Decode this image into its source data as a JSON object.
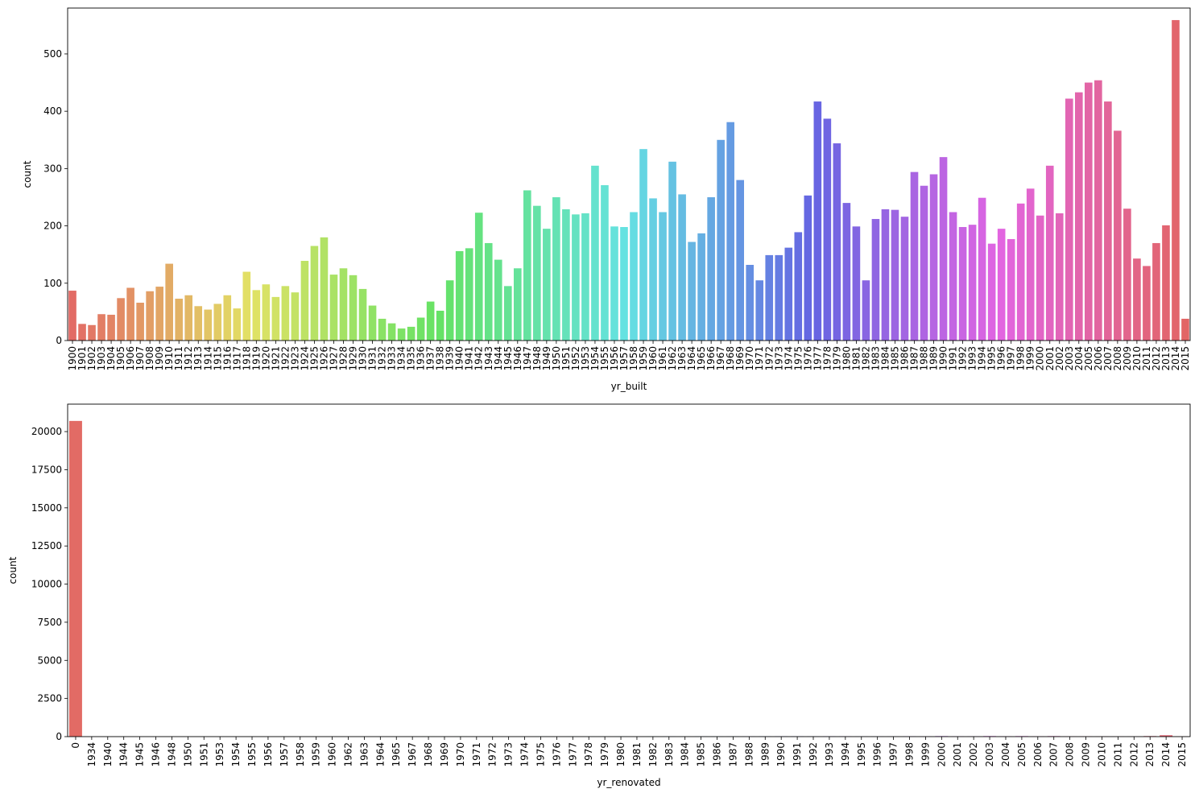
{
  "chart_data": [
    {
      "type": "bar",
      "xlabel": "yr_built",
      "ylabel": "count",
      "ylim": [
        0,
        580
      ],
      "yticks": [
        0,
        100,
        200,
        300,
        400,
        500
      ],
      "grid": false,
      "legend": "none",
      "palette": "husl",
      "categories": [
        "1900",
        "1901",
        "1902",
        "1903",
        "1904",
        "1905",
        "1906",
        "1907",
        "1908",
        "1909",
        "1910",
        "1911",
        "1912",
        "1913",
        "1914",
        "1915",
        "1916",
        "1917",
        "1918",
        "1919",
        "1920",
        "1921",
        "1922",
        "1923",
        "1924",
        "1925",
        "1926",
        "1927",
        "1928",
        "1929",
        "1930",
        "1931",
        "1932",
        "1933",
        "1934",
        "1935",
        "1936",
        "1937",
        "1938",
        "1939",
        "1940",
        "1941",
        "1942",
        "1943",
        "1944",
        "1945",
        "1946",
        "1947",
        "1948",
        "1949",
        "1950",
        "1951",
        "1952",
        "1953",
        "1954",
        "1955",
        "1956",
        "1957",
        "1958",
        "1959",
        "1960",
        "1961",
        "1962",
        "1963",
        "1964",
        "1965",
        "1966",
        "1967",
        "1968",
        "1969",
        "1970",
        "1971",
        "1972",
        "1973",
        "1974",
        "1975",
        "1976",
        "1977",
        "1978",
        "1979",
        "1980",
        "1981",
        "1982",
        "1983",
        "1984",
        "1985",
        "1986",
        "1987",
        "1988",
        "1989",
        "1990",
        "1991",
        "1992",
        "1993",
        "1994",
        "1995",
        "1996",
        "1997",
        "1998",
        "1999",
        "2000",
        "2001",
        "2002",
        "2003",
        "2004",
        "2005",
        "2006",
        "2007",
        "2008",
        "2009",
        "2010",
        "2011",
        "2012",
        "2013",
        "2014",
        "2015"
      ],
      "values": [
        87,
        29,
        27,
        46,
        45,
        74,
        92,
        66,
        86,
        94,
        134,
        73,
        79,
        60,
        54,
        64,
        79,
        56,
        120,
        88,
        98,
        76,
        95,
        84,
        139,
        165,
        180,
        115,
        126,
        114,
        90,
        61,
        38,
        30,
        21,
        24,
        40,
        68,
        52,
        105,
        156,
        161,
        223,
        170,
        141,
        95,
        126,
        262,
        235,
        195,
        250,
        229,
        220,
        222,
        305,
        271,
        199,
        198,
        224,
        334,
        248,
        224,
        312,
        255,
        172,
        187,
        250,
        350,
        381,
        280,
        132,
        105,
        149,
        149,
        162,
        189,
        253,
        417,
        387,
        344,
        240,
        199,
        105,
        212,
        229,
        228,
        216,
        294,
        270,
        290,
        320,
        224,
        198,
        202,
        249,
        169,
        195,
        177,
        239,
        265,
        218,
        305,
        222,
        422,
        433,
        450,
        454,
        417,
        366,
        230,
        143,
        130,
        170,
        201,
        559,
        38
      ]
    },
    {
      "type": "bar",
      "xlabel": "yr_renovated",
      "ylabel": "count",
      "ylim": [
        0,
        21800
      ],
      "yticks": [
        0,
        2500,
        5000,
        7500,
        10000,
        12500,
        15000,
        17500,
        20000
      ],
      "grid": false,
      "legend": "none",
      "palette": "husl",
      "categories": [
        "0",
        "1934",
        "1940",
        "1944",
        "1945",
        "1946",
        "1948",
        "1950",
        "1951",
        "1953",
        "1954",
        "1955",
        "1956",
        "1957",
        "1958",
        "1959",
        "1960",
        "1962",
        "1963",
        "1964",
        "1965",
        "1967",
        "1968",
        "1969",
        "1970",
        "1971",
        "1972",
        "1973",
        "1974",
        "1975",
        "1976",
        "1977",
        "1978",
        "1979",
        "1980",
        "1981",
        "1982",
        "1983",
        "1984",
        "1985",
        "1986",
        "1987",
        "1988",
        "1989",
        "1990",
        "1991",
        "1992",
        "1993",
        "1994",
        "1995",
        "1996",
        "1997",
        "1998",
        "1999",
        "2000",
        "2001",
        "2002",
        "2003",
        "2004",
        "2005",
        "2006",
        "2007",
        "2008",
        "2009",
        "2010",
        "2011",
        "2012",
        "2013",
        "2014",
        "2015"
      ],
      "values": [
        20699,
        1,
        1,
        2,
        3,
        2,
        1,
        2,
        1,
        4,
        1,
        3,
        3,
        3,
        5,
        5,
        4,
        2,
        4,
        3,
        5,
        2,
        8,
        4,
        9,
        2,
        4,
        5,
        3,
        6,
        3,
        8,
        6,
        10,
        11,
        4,
        11,
        18,
        8,
        17,
        17,
        18,
        15,
        22,
        25,
        20,
        17,
        19,
        19,
        16,
        15,
        15,
        19,
        18,
        35,
        19,
        22,
        36,
        26,
        35,
        24,
        35,
        18,
        22,
        18,
        13,
        11,
        37,
        91,
        16
      ]
    }
  ]
}
